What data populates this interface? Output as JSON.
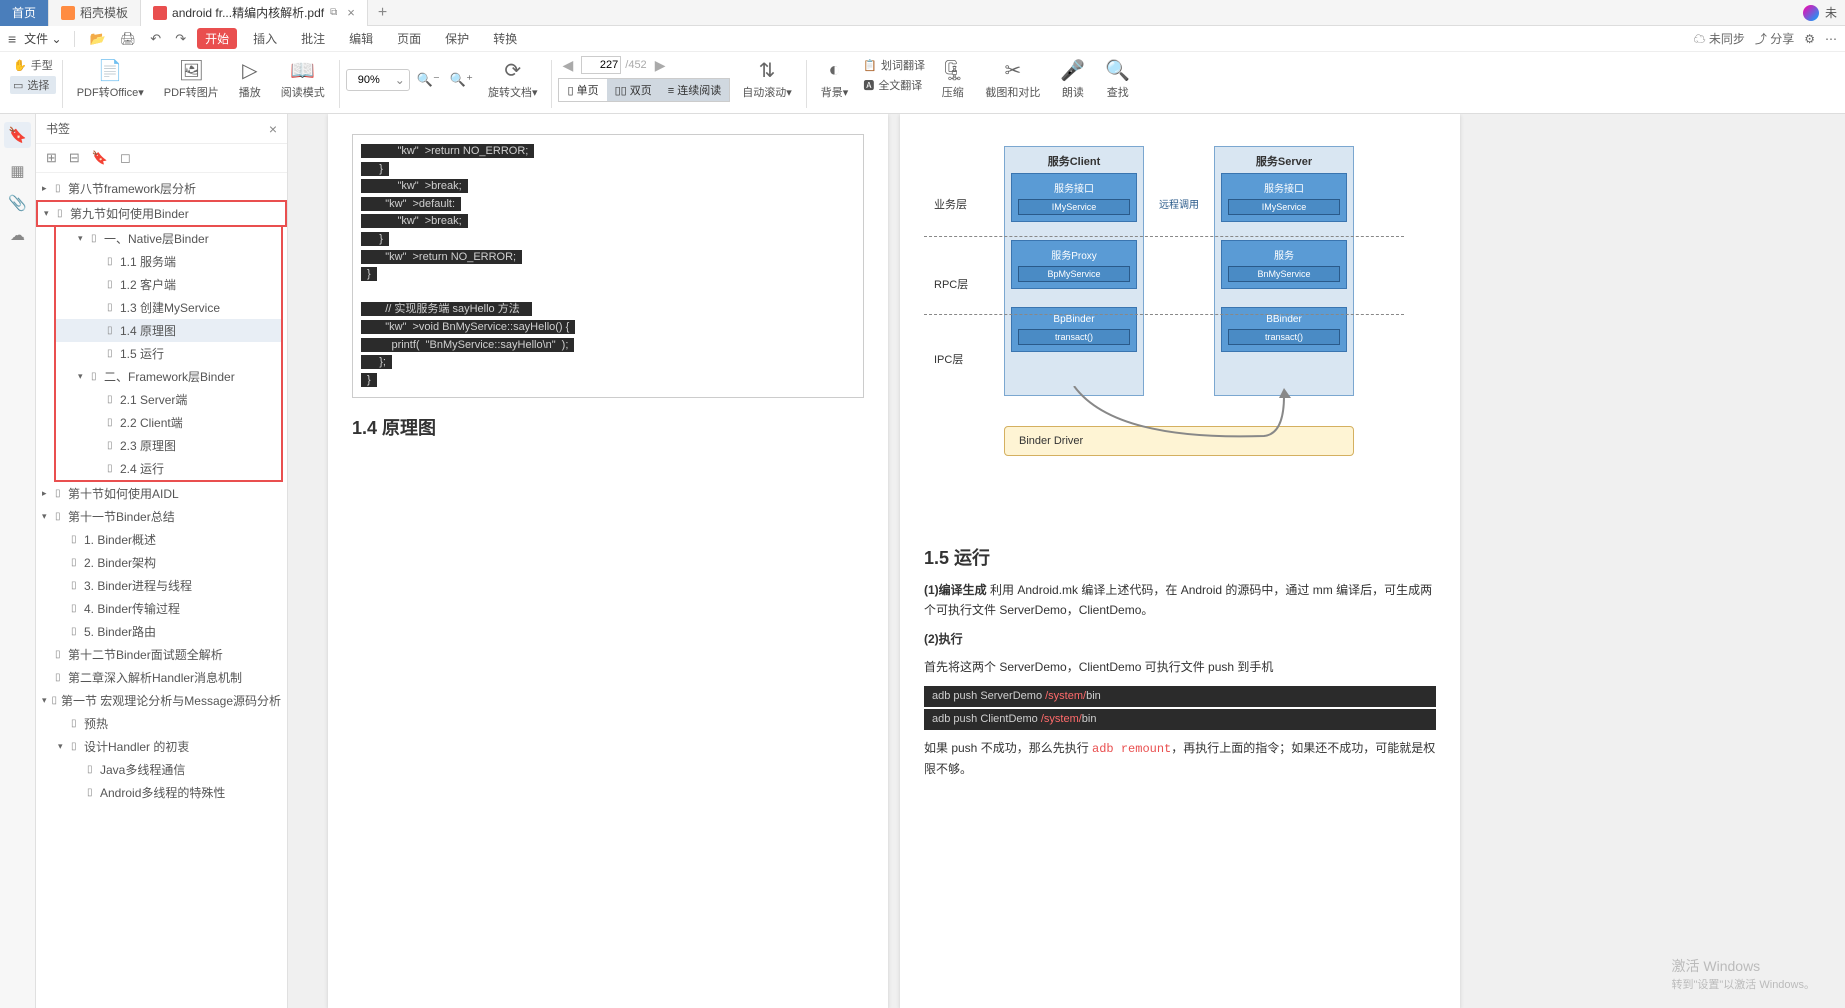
{
  "tabs": {
    "home": "首页",
    "template": "稻壳模板",
    "active": "android fr...精编内核解析.pdf",
    "user": "未"
  },
  "menubar": {
    "file": "文件",
    "start": "开始",
    "insert": "插入",
    "review": "批注",
    "edit": "编辑",
    "page": "页面",
    "protect": "保护",
    "convert": "转换",
    "unsync": "未同步",
    "share": "分享"
  },
  "toolbar": {
    "hand": "手型",
    "select": "选择",
    "pdf2office": "PDF转Office",
    "pdf2img": "PDF转图片",
    "play": "播放",
    "readmode": "阅读模式",
    "zoom": "90%",
    "rotate": "旋转文档",
    "single": "单页",
    "double": "双页",
    "continuous": "连续阅读",
    "autoscroll": "自动滚动",
    "bg": "背景",
    "seltrans": "划词翻译",
    "fulltrans": "全文翻译",
    "compress": "压缩",
    "screenshot": "截图和对比",
    "read": "朗读",
    "find": "查找",
    "page_current": "227",
    "page_total": "/452"
  },
  "sidebar": {
    "title": "书签",
    "items": [
      {
        "indent": 0,
        "arrow": "▸",
        "label": "第八节framework层分析"
      },
      {
        "indent": 0,
        "arrow": "▾",
        "label": "第九节如何使用Binder",
        "red1": true
      },
      {
        "indent": 1,
        "arrow": "▾",
        "label": "一、Native层Binder"
      },
      {
        "indent": 2,
        "arrow": "",
        "label": "1.1 服务端"
      },
      {
        "indent": 2,
        "arrow": "",
        "label": "1.2 客户端"
      },
      {
        "indent": 2,
        "arrow": "",
        "label": "1.3 创建MyService"
      },
      {
        "indent": 2,
        "arrow": "",
        "label": "1.4 原理图",
        "selected": true
      },
      {
        "indent": 2,
        "arrow": "",
        "label": "1.5 运行"
      },
      {
        "indent": 1,
        "arrow": "▾",
        "label": "二、Framework层Binder"
      },
      {
        "indent": 2,
        "arrow": "",
        "label": "2.1 Server端"
      },
      {
        "indent": 2,
        "arrow": "",
        "label": "2.2 Client端"
      },
      {
        "indent": 2,
        "arrow": "",
        "label": "2.3 原理图"
      },
      {
        "indent": 2,
        "arrow": "",
        "label": "2.4 运行"
      },
      {
        "indent": 0,
        "arrow": "▸",
        "label": "第十节如何使用AIDL"
      },
      {
        "indent": 0,
        "arrow": "▾",
        "label": "第十一节Binder总结"
      },
      {
        "indent": 1,
        "arrow": "",
        "label": "1. Binder概述"
      },
      {
        "indent": 1,
        "arrow": "",
        "label": "2. Binder架构"
      },
      {
        "indent": 1,
        "arrow": "",
        "label": "3. Binder进程与线程"
      },
      {
        "indent": 1,
        "arrow": "",
        "label": "4. Binder传输过程"
      },
      {
        "indent": 1,
        "arrow": "",
        "label": "5. Binder路由"
      },
      {
        "indent": 0,
        "arrow": "",
        "label": "第十二节Binder面试题全解析"
      },
      {
        "indent": 0,
        "arrow": "",
        "label": "第二章深入解析Handler消息机制"
      },
      {
        "indent": 0,
        "arrow": "▾",
        "label": "第一节 宏观理论分析与Message源码分析"
      },
      {
        "indent": 1,
        "arrow": "",
        "label": "预热"
      },
      {
        "indent": 1,
        "arrow": "▾",
        "label": "设计Handler 的初衷"
      },
      {
        "indent": 2,
        "arrow": "",
        "label": "Java多线程通信"
      },
      {
        "indent": 2,
        "arrow": "",
        "label": "Android多线程的特殊性"
      }
    ]
  },
  "page_left": {
    "code1": [
      "        return NO_ERROR;",
      "    }",
      "        break;",
      "    default:",
      "        break;",
      "    }",
      "    return NO_ERROR;",
      "}",
      "",
      "    // 实现服务端 sayHello 方法",
      "    void BnMyService::sayHello() {",
      "        printf(\"BnMyService::sayHello\\n\");",
      "    };",
      "}"
    ],
    "heading": "1.4  原理图"
  },
  "page_right": {
    "diagram": {
      "client_title": "服务Client",
      "server_title": "服务Server",
      "intf_label": "服务接口",
      "intf_inner": "IMyService",
      "proxy_label": "服务Proxy",
      "proxy_inner": "BpMyService",
      "svc_label": "服务",
      "svc_inner": "BnMyService",
      "bpbinder": "BpBinder",
      "bbinder": "BBinder",
      "transact": "transact()",
      "layer_biz": "业务层",
      "layer_rpc": "RPC层",
      "layer_ipc": "IPC层",
      "remote_call": "远程调用",
      "driver": "Binder Driver"
    },
    "heading": "1.5  运行",
    "p1_label": "(1)编译生成",
    "p1": "利用 Android.mk 编译上述代码，在 Android 的源码中，通过 mm 编译后，可生成两个可执行文件 ServerDemo，ClientDemo。",
    "p2_label": "(2)执行",
    "p3": "首先将这两个 ServerDemo，ClientDemo 可执行文件 push 到手机",
    "cmd1_a": "adb push ServerDemo ",
    "cmd1_b": "/system/",
    "cmd1_c": "bin",
    "cmd2_a": "adb push ClientDemo ",
    "cmd2_b": "/system/",
    "cmd2_c": "bin",
    "p4_a": "如果 push 不成功，那么先执行 ",
    "p4_b": "adb remount",
    "p4_c": "，再执行上面的指令；如果还不成功，可能就是权限不够。"
  },
  "watermark": {
    "l1": "激活 Windows",
    "l2": "转到\"设置\"以激活 Windows。"
  }
}
